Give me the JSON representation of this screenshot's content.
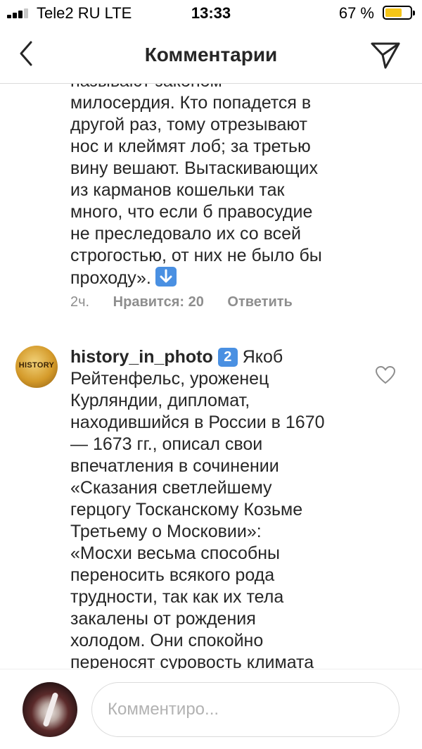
{
  "status_bar": {
    "carrier": "Tele2 RU  LTE",
    "time": "13:33",
    "battery_percent": "67 %",
    "battery_level": 0.67,
    "battery_color": "#f5c518"
  },
  "header": {
    "title": "Комментарии",
    "back_icon": "chevron-left-icon",
    "send_icon": "paper-plane-icon"
  },
  "comments": [
    {
      "lines": [
        "называют законом",
        "милосердия. Кто попадется в",
        "другой раз, тому отрезывают",
        "нос и клеймят лоб; за третью",
        "вину вешают. Вытаскивающих",
        "из карманов кошельки так",
        "много, что если б правосудие",
        "не преследовало их со всей",
        "строгостью, от них не было бы"
      ],
      "last_line": "проходу».",
      "emoji": "down-arrow-emoji-icon",
      "time": "2ч.",
      "likes": "Нравится: 20",
      "reply": "Ответить"
    },
    {
      "avatar_text": "HISTORY",
      "username": "history_in_photo",
      "badge": "2",
      "first_line_text": "Якоб",
      "lines": [
        "Рейтенфельс, уроженец",
        "Курляндии, дипломат,",
        "находившийся в России в 1670",
        "— 1673 гг., описал свои",
        "впечатления в сочинении",
        "«Сказания светлейшему",
        "герцогу Тосканскому Козьме",
        "Третьему о Московии»:",
        "«Мосхи весьма способны",
        "переносить всякого рода",
        "трудности, так как их тела",
        "закалены от рождения",
        "холодом. Они спокойно",
        "переносят суровость климата"
      ]
    }
  ],
  "composer": {
    "placeholder": "Комментиро..."
  },
  "colors": {
    "accent_blue": "#4a90e2",
    "text": "#262626",
    "muted": "#8e8e8e"
  }
}
